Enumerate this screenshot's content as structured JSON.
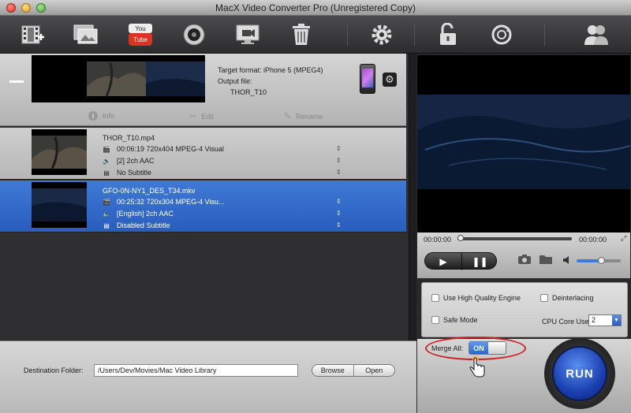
{
  "window": {
    "title": "MacX Video Converter Pro (Unregistered Copy)"
  },
  "toolbar": {
    "icons": [
      "add-video-icon",
      "photo-slideshow-icon",
      "youtube-icon",
      "dvd-icon",
      "screen-recorder-icon",
      "trash-icon",
      "settings-icon",
      "unlock-icon",
      "update-icon",
      "users-icon"
    ]
  },
  "target": {
    "format_label": "Target format: iPhone 5 (MPEG4)",
    "output_label": "Output file:",
    "output_name": "THOR_T10"
  },
  "actions": {
    "info": "Info",
    "edit": "Edit",
    "rename": "Rename"
  },
  "files": [
    {
      "name": "THOR_T10.mp4",
      "video": "00:06:19 720x404 MPEG-4 Visual",
      "audio": "[2] 2ch AAC",
      "subtitle": "No Subtitle"
    },
    {
      "name": "GFO-0N-NY1_DES_T34.mkv",
      "video": "00:25:32 720x304 MPEG-4 Visu...",
      "audio": "[English] 2ch AAC",
      "subtitle": "Disabled Subtitle"
    }
  ],
  "destination": {
    "label": "Destination Folder:",
    "path": "/Users/Dev/Movies/Mac Video Library",
    "browse": "Browse",
    "open": "Open"
  },
  "player": {
    "time_start": "00:00:00",
    "time_end": "00:00:00",
    "volume_fraction": 0.55
  },
  "settings": {
    "hq_engine": "Use High Quality Engine",
    "deinterlacing": "Deinterlacing",
    "safe_mode": "Safe Mode",
    "cpu_label": "CPU Core Use:",
    "cpu_value": "2"
  },
  "merge": {
    "label": "Merge All:",
    "state": "ON"
  },
  "run": {
    "label": "RUN"
  },
  "colors": {
    "selected_row": "#3f79d6",
    "accent_red": "#c22222",
    "run_blue": "#1a3fb0"
  }
}
